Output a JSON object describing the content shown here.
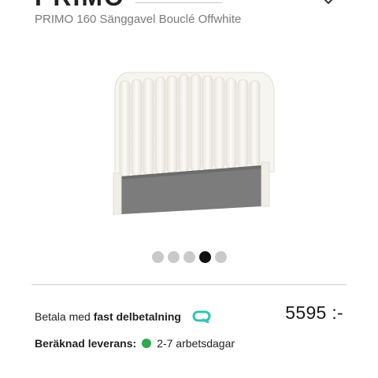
{
  "header": {
    "brand_fragment": "PRIMO",
    "product_title": "PRIMO 160 Sänggavel Bouclé Offwhite"
  },
  "gallery": {
    "image_alt": "Sänggavel Bouclé Offwhite",
    "dot_count": 5,
    "active_index": 3
  },
  "payment": {
    "prefix": "Betala med ",
    "method": "fast delbetalning",
    "price": "5595 :-"
  },
  "delivery": {
    "label": "Beräknad leverans:",
    "value": "2-7 arbetsdagar",
    "status_color": "#2fa84f"
  },
  "colors": {
    "qliro_teal": "#2ec4b6",
    "fabric_grey": "#7c7c7c",
    "bed_offwhite": "#f7f5ef"
  }
}
